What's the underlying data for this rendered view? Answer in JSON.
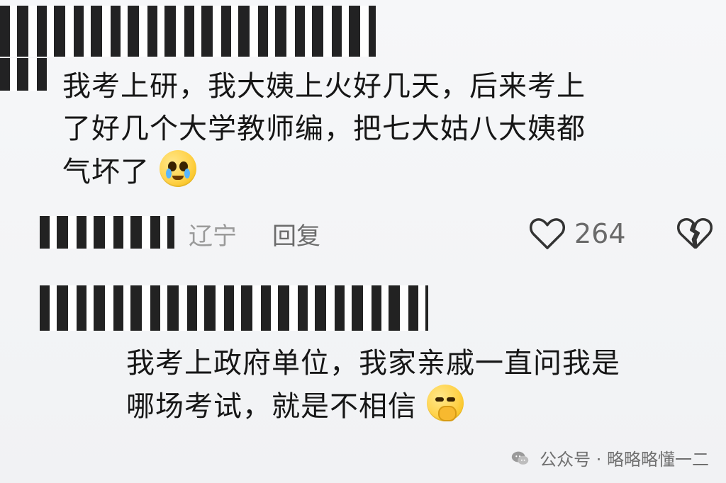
{
  "comments": [
    {
      "lines": [
        "我考上研，我大姨上火好几天，后来考上",
        "了好几个大学教师编，把七大姑八大姨都",
        "气坏了"
      ],
      "location": "辽宁",
      "reply_label": "回复",
      "likes": "264"
    },
    {
      "lines": [
        "我考上政府单位，我家亲戚一直问我是",
        "哪场考试，就是不相信"
      ]
    }
  ],
  "footer": {
    "text": "公众号 · 略略略懂一二"
  },
  "icons": {
    "cry": "crying-emoji-icon",
    "smirk": "smirking-emoji-icon",
    "like": "heart-icon",
    "dislike": "broken-heart-icon",
    "wechat": "wechat-icon"
  }
}
